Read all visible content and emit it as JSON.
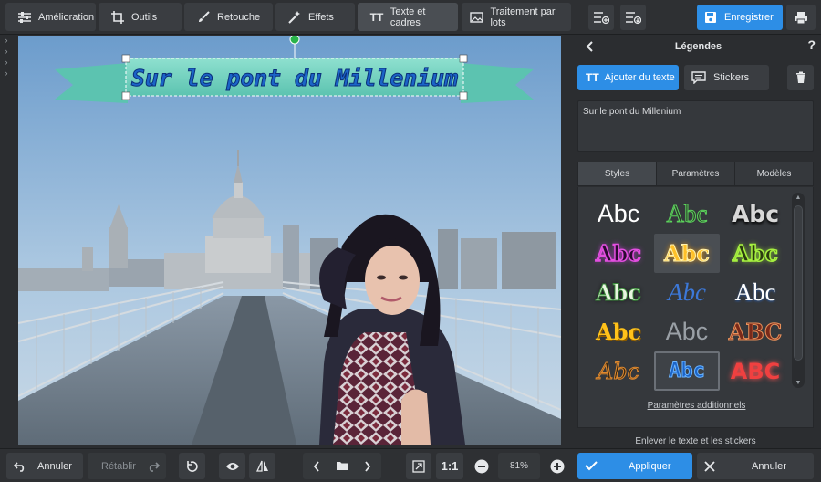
{
  "toolbar": {
    "tabs": [
      {
        "label": "Amélioration",
        "icon": "sliders-icon"
      },
      {
        "label": "Outils",
        "icon": "crop-icon"
      },
      {
        "label": "Retouche",
        "icon": "brush-icon"
      },
      {
        "label": "Effets",
        "icon": "magic-wand-icon"
      },
      {
        "label": "Texte et cadres",
        "icon": "text-icon"
      },
      {
        "label": "Traitement par lots",
        "icon": "image-stack-icon"
      }
    ],
    "save_label": "Enregistrer"
  },
  "canvas": {
    "banner_text": "Sur le pont du Millenium"
  },
  "panel": {
    "title": "Légendes",
    "help": "?",
    "add_text_label": "Ajouter du texte",
    "add_text_icon": "TT",
    "stickers_label": "Stickers",
    "text_value": "Sur le pont du Millenium",
    "tabs": [
      "Styles",
      "Paramètres",
      "Modèles"
    ],
    "styles": [
      {
        "label": "Abc"
      },
      {
        "label": "Abc"
      },
      {
        "label": "Abc"
      },
      {
        "label": "Abc"
      },
      {
        "label": "Abc"
      },
      {
        "label": "Abc"
      },
      {
        "label": "Abc"
      },
      {
        "label": "Abc"
      },
      {
        "label": "Abc"
      },
      {
        "label": "Abc"
      },
      {
        "label": "Abc"
      },
      {
        "label": "ABC"
      },
      {
        "label": "Abc"
      },
      {
        "label": "Abc"
      },
      {
        "label": "ABC"
      }
    ],
    "more_params": "Paramètres additionnels",
    "remove_label": "Enlever le texte et les stickers"
  },
  "bottom": {
    "undo_label": "Annuler",
    "redo_label": "Rétablir",
    "ratio_label": "1:1",
    "zoom_value": "81%",
    "apply_label": "Appliquer",
    "cancel_label": "Annuler"
  }
}
